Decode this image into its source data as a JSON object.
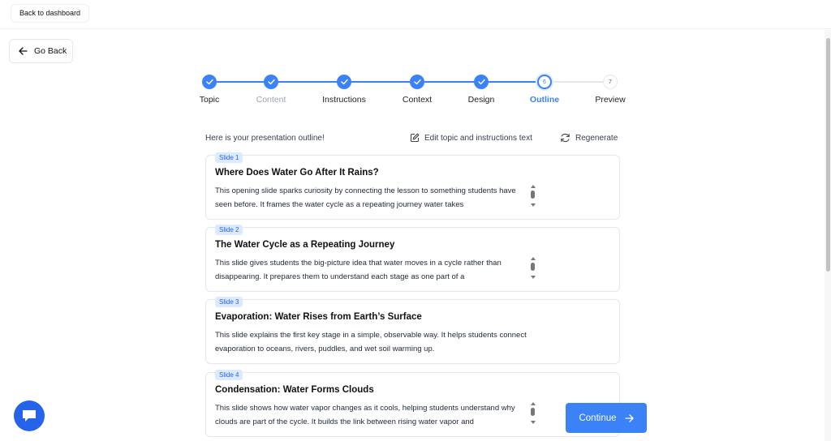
{
  "topbar": {
    "back_to_dashboard": "Back to dashboard"
  },
  "nav": {
    "go_back": "Go Back"
  },
  "stepper": {
    "steps": [
      {
        "label": "Topic",
        "state": "done",
        "number": "1"
      },
      {
        "label": "Content",
        "state": "done",
        "number": "2"
      },
      {
        "label": "Instructions",
        "state": "done",
        "number": "3"
      },
      {
        "label": "Context",
        "state": "done",
        "number": "4"
      },
      {
        "label": "Design",
        "state": "done",
        "number": "5"
      },
      {
        "label": "Outline",
        "state": "current",
        "number": "6"
      },
      {
        "label": "Preview",
        "state": "todo",
        "number": "7"
      }
    ]
  },
  "outline": {
    "intro": "Here is your presentation outline!",
    "edit_label": "Edit topic and instructions text",
    "regenerate_label": "Regenerate",
    "slides": [
      {
        "badge": "Slide 1",
        "title": "Where Does Water Go After It Rains?",
        "body": "This opening slide sparks curiosity by connecting the lesson to something students have seen before. It frames the water cycle as a repeating journey water takes"
      },
      {
        "badge": "Slide 2",
        "title": "The Water Cycle as a Repeating Journey",
        "body": "This slide gives students the big-picture idea that water moves in a cycle rather than disappearing. It prepares them to understand each stage as one part of a"
      },
      {
        "badge": "Slide 3",
        "title": "Evaporation: Water Rises from Earth’s Surface",
        "body": "This slide explains the first key stage in a simple, observable way. It helps students connect evaporation to oceans, rivers, puddles, and wet soil warming up."
      },
      {
        "badge": "Slide 4",
        "title": "Condensation: Water Forms Clouds",
        "body": "This slide shows how water vapor changes as it cools, helping students understand why clouds are part of the cycle. It builds the link between rising water vapor and"
      }
    ]
  },
  "actions": {
    "continue_label": "Continue"
  },
  "colors": {
    "accent": "#3b82f6",
    "badge_bg": "#dbeafe"
  }
}
